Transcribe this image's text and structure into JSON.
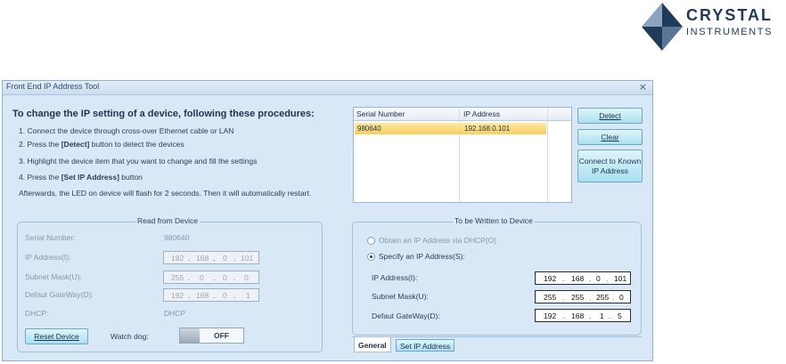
{
  "brand": {
    "line1": "CRYSTAL",
    "line2": "INSTRUMENTS",
    "color_dark": "#203a5c",
    "color_light": "#8ea3bd"
  },
  "window": {
    "title": "Front End IP Address Tool",
    "close_label": "×"
  },
  "instructions": {
    "title": "To change the IP setting of a device, following these procedures:",
    "step1": "1. Connect the device through cross-over Ethernet cable or LAN",
    "step2_pre": "2.  Press the ",
    "step2_kw": "[Detect]",
    "step2_post": " button to detect the devices",
    "step3": "3. Highlight the device item that you want to change and fill the settings",
    "step4_pre": "4.  Press the ",
    "step4_kw": "[Set  IP  Address]",
    "step4_post": " button",
    "note": "Afterwards, the LED on device will flash for 2 seconds. Then it will automatically restart."
  },
  "device_table": {
    "columns": [
      "Serial Number",
      "IP Address"
    ],
    "rows": [
      {
        "serial": "980640",
        "ip": "192.168.0.101"
      }
    ],
    "selected_color": "#f8cf5e"
  },
  "buttons": {
    "detect": "Detect",
    "clear": "Clear",
    "connect_line1": "Connect to Known",
    "connect_line2": "IP Address",
    "reset_device": "Reset Device"
  },
  "read_from_device": {
    "title": "Read from Device",
    "serial_label": "Serial Number:",
    "serial_value": "980640",
    "ip_label": "IP Address(I):",
    "ip": [
      "192",
      "168",
      "0",
      "101"
    ],
    "subnet_label": "Subnet Mask(U):",
    "subnet": [
      "255",
      "0",
      "0",
      "0"
    ],
    "gateway_label": "Defaut GateWay(D):",
    "gateway": [
      "192",
      "168",
      "0",
      "1"
    ],
    "dhcp_label": "DHCP:",
    "dhcp_value": "DHCP",
    "watchdog_label": "Watch dog:",
    "watchdog_state": "OFF"
  },
  "write_to_device": {
    "title": "To be Written to Device",
    "radio_dhcp": "Obtain an IP Address via DHCP(O)",
    "radio_specify": "Specify an IP Address(S):",
    "selected_option": "specify",
    "ip_label": "IP Address(I):",
    "ip": [
      "192",
      "168",
      "0",
      "101"
    ],
    "subnet_label": "Subnet Mask(U):",
    "subnet": [
      "255",
      "255",
      "255",
      "0"
    ],
    "gateway_label": "Defaut GateWay(D):",
    "gateway": [
      "192",
      "168",
      "1",
      "5"
    ]
  },
  "tabs": {
    "general": "General",
    "set_ip": "Set IP Address",
    "active": "general"
  }
}
